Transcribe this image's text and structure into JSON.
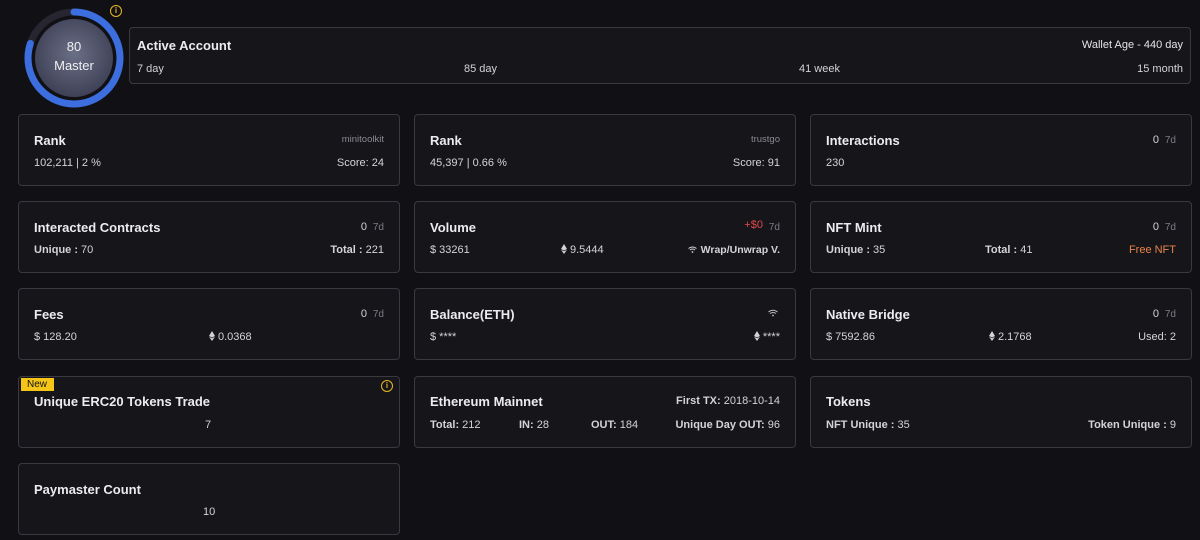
{
  "level": {
    "score": "80",
    "title": "Master",
    "ring_color": "#3d6ee0",
    "progress": 0.8
  },
  "active_account": {
    "title": "Active Account",
    "wallet_age": "Wallet Age - 440 day",
    "periods": [
      "7 day",
      "85 day",
      "41 week",
      "15 month"
    ]
  },
  "cards": {
    "rank_minitoolkit": {
      "title": "Rank",
      "source": "minitoolkit",
      "value": "102,211 | 2 %",
      "score": "Score: 24"
    },
    "rank_trustgo": {
      "title": "Rank",
      "source": "trustgo",
      "value": "45,397 | 0.66 %",
      "score": "Score: 91"
    },
    "interactions": {
      "title": "Interactions",
      "delta": "0",
      "period": "7d",
      "value": "230"
    },
    "interacted_contracts": {
      "title": "Interacted Contracts",
      "delta": "0",
      "period": "7d",
      "unique_label": "Unique :",
      "unique_value": " 70",
      "total_label": "Total :",
      "total_value": " 221"
    },
    "volume": {
      "title": "Volume",
      "delta": "+$0",
      "period": "7d",
      "usd": "$ 33261",
      "eth": "9.5444",
      "wrap": "Wrap/Unwrap V."
    },
    "nft_mint": {
      "title": "NFT Mint",
      "delta": "0",
      "period": "7d",
      "unique_label": "Unique :",
      "unique_value": " 35",
      "total_label": "Total :",
      "total_value": " 41",
      "free": "Free NFT"
    },
    "fees": {
      "title": "Fees",
      "delta": "0",
      "period": "7d",
      "usd": "$ 128.20",
      "eth": "0.0368"
    },
    "balance": {
      "title": "Balance(ETH)",
      "usd": "$ ****",
      "eth": "****"
    },
    "native_bridge": {
      "title": "Native Bridge",
      "delta": "0",
      "period": "7d",
      "usd": "$ 7592.86",
      "eth": "2.1768",
      "used": "Used: 2"
    },
    "erc20": {
      "badge": "New",
      "title": "Unique ERC20 Tokens Trade",
      "value": "7"
    },
    "mainnet": {
      "title": "Ethereum Mainnet",
      "first_tx_label": "First TX:",
      "first_tx": " 2018-10-14",
      "total_label": "Total:",
      "total": " 212",
      "in_label": "IN:",
      "in": " 28",
      "out_label": "OUT:",
      "out": " 184",
      "unique_out_label": "Unique Day OUT:",
      "unique_out": " 96"
    },
    "tokens": {
      "title": "Tokens",
      "nft_unique_label": "NFT Unique :",
      "nft_unique": " 35",
      "token_unique_label": "Token Unique :",
      "token_unique": " 9"
    },
    "paymaster": {
      "title": "Paymaster Count",
      "value": "10"
    }
  },
  "colors": {
    "accent_red": "#e24a4a",
    "accent_orange": "#e8844a",
    "badge_yellow": "#f5c518"
  }
}
